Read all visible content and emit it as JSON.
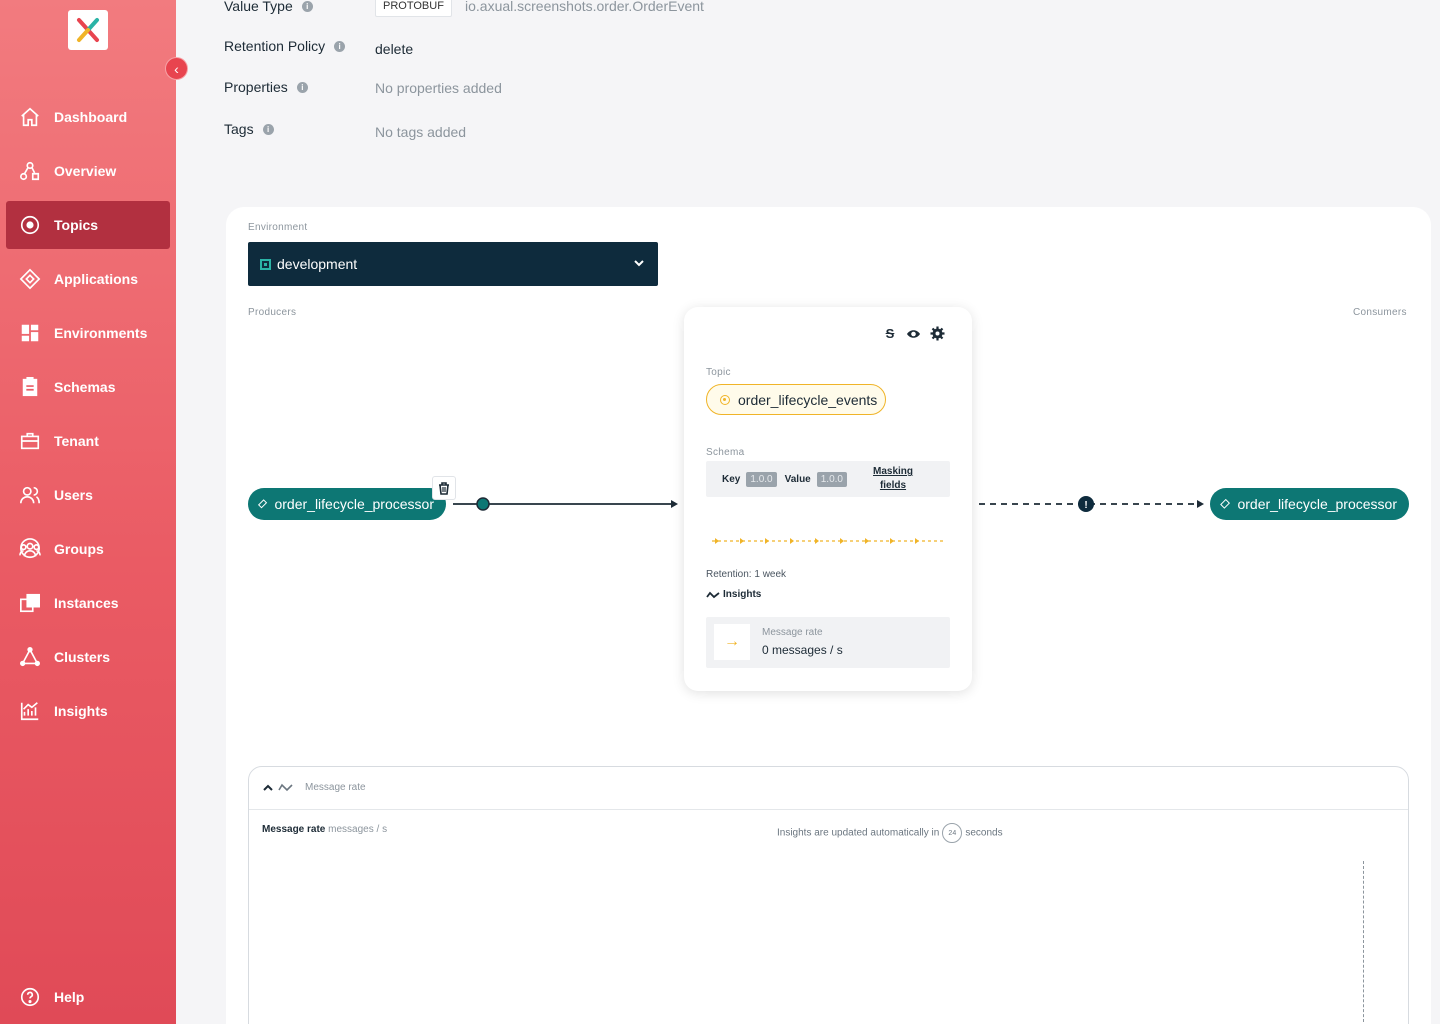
{
  "sidebar": {
    "collapse_label": "‹",
    "items": [
      {
        "label": "Dashboard",
        "icon": "home-icon"
      },
      {
        "label": "Overview",
        "icon": "overview-icon"
      },
      {
        "label": "Topics",
        "icon": "topics-icon",
        "active": true
      },
      {
        "label": "Applications",
        "icon": "applications-icon"
      },
      {
        "label": "Environments",
        "icon": "environments-icon"
      },
      {
        "label": "Schemas",
        "icon": "schemas-icon"
      },
      {
        "label": "Tenant",
        "icon": "tenant-icon"
      },
      {
        "label": "Users",
        "icon": "users-icon"
      },
      {
        "label": "Groups",
        "icon": "groups-icon"
      },
      {
        "label": "Instances",
        "icon": "instances-icon"
      },
      {
        "label": "Clusters",
        "icon": "clusters-icon"
      },
      {
        "label": "Insights",
        "icon": "insights-icon"
      }
    ],
    "help": {
      "label": "Help",
      "icon": "help-icon"
    }
  },
  "properties": {
    "value_type": {
      "label": "Value Type",
      "chip": "PROTOBUF",
      "value": "io.axual.screenshots.order.OrderEvent"
    },
    "retention_policy": {
      "label": "Retention Policy",
      "value": "delete"
    },
    "properties": {
      "label": "Properties",
      "value": "No properties added"
    },
    "tags": {
      "label": "Tags",
      "value": "No tags added"
    }
  },
  "environment": {
    "label": "Environment",
    "selected": "development"
  },
  "flow": {
    "producers_label": "Producers",
    "consumers_label": "Consumers",
    "producer": "order_lifecycle_processor",
    "consumer": "order_lifecycle_processor"
  },
  "topic_card": {
    "topic_label": "Topic",
    "topic_name": "order_lifecycle_events",
    "schema_label": "Schema",
    "key_label": "Key",
    "key_version": "1.0.0",
    "value_label": "Value",
    "value_version": "1.0.0",
    "masking_line1": "Masking",
    "masking_line2": "fields",
    "retention": "Retention: 1 week",
    "insights_label": "Insights",
    "message_rate_label": "Message rate",
    "message_rate_value": "0 messages / s"
  },
  "insights_panel": {
    "header": "Message rate",
    "title": "Message rate",
    "unit": "messages / s",
    "update_text_before": "Insights are updated automatically in",
    "countdown": "24",
    "update_text_after": "seconds"
  },
  "colors": {
    "accent_red": "#e8444f",
    "teal": "#0d7774",
    "navy": "#0e2b3d",
    "topic_yellow": "#f0b428"
  }
}
